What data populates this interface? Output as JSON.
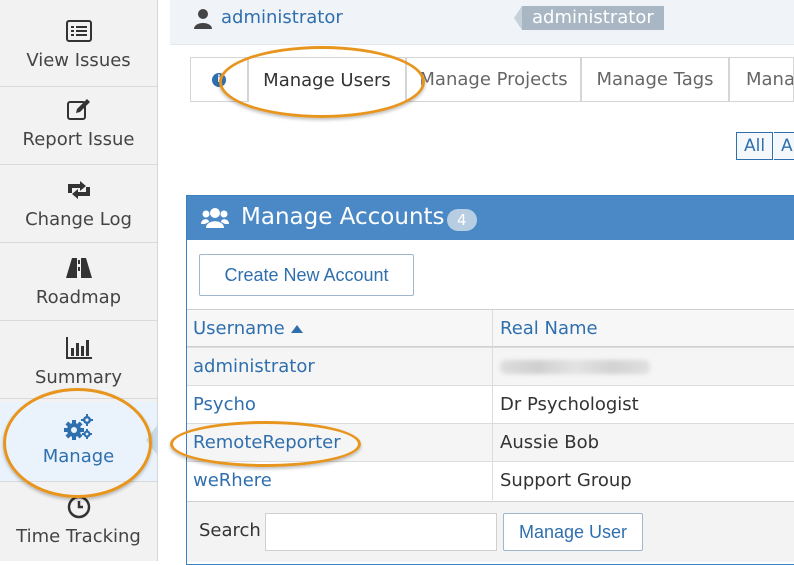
{
  "sidebar": {
    "items": [
      {
        "label": "View Issues",
        "icon": "list-icon"
      },
      {
        "label": "Report Issue",
        "icon": "edit-icon"
      },
      {
        "label": "Change Log",
        "icon": "retweet-icon"
      },
      {
        "label": "Roadmap",
        "icon": "road-icon"
      },
      {
        "label": "Summary",
        "icon": "bar-chart-icon"
      },
      {
        "label": "Manage",
        "icon": "gears-icon",
        "active": true
      },
      {
        "label": "Time Tracking",
        "icon": "clock-icon"
      }
    ]
  },
  "breadcrumb": {
    "user_link": "administrator",
    "access_level": "administrator"
  },
  "tabs": [
    {
      "label": "",
      "icon": "info-icon"
    },
    {
      "label": "Manage Users",
      "active": true
    },
    {
      "label": "Manage Projects"
    },
    {
      "label": "Manage Tags"
    },
    {
      "label": "Mana"
    }
  ],
  "filters": {
    "all_label": "All",
    "next_label": "A"
  },
  "accounts": {
    "title": "Manage Accounts",
    "count": "4",
    "create_button": "Create New Account",
    "columns": {
      "username": "Username",
      "realname": "Real Name"
    },
    "rows": [
      {
        "username": "administrator",
        "realname": ""
      },
      {
        "username": "Psycho",
        "realname": "Dr Psychologist"
      },
      {
        "username": "RemoteReporter",
        "realname": "Aussie Bob"
      },
      {
        "username": "weRhere",
        "realname": "Support Group"
      }
    ],
    "search_label": "Search",
    "search_value": "",
    "manage_user_button": "Manage User"
  },
  "colors": {
    "accent": "#2f6fae",
    "panel_header": "#4a89c6",
    "highlight": "#e8951e"
  }
}
